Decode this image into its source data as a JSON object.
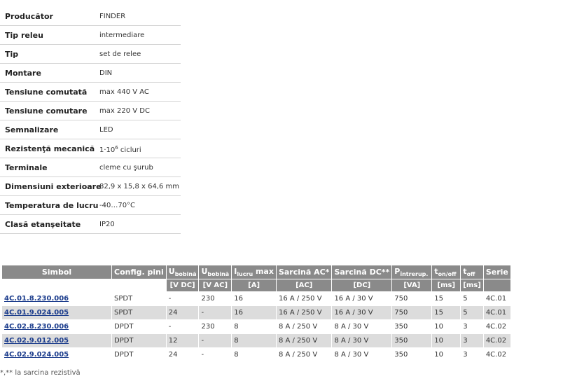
{
  "specs": [
    {
      "label": "Producător",
      "value": "FINDER"
    },
    {
      "label": "Tip releu",
      "value": "intermediare"
    },
    {
      "label": "Tip",
      "value": "set de relee"
    },
    {
      "label": "Montare",
      "value": "DIN"
    },
    {
      "label": "Tensiune comutată",
      "value": "max 440 V AC"
    },
    {
      "label": "Tensiune comutare",
      "value": "max 220 V DC"
    },
    {
      "label": "Semnalizare",
      "value": "LED"
    },
    {
      "label": "Rezistenţă mecanică",
      "value_prefix": "1·10",
      "value_sup": "6",
      "value_suffix": " cicluri"
    },
    {
      "label": "Terminale",
      "value": "cleme cu şurub"
    },
    {
      "label": "Dimensiuni exterioare",
      "value": "82,9 x 15,8 x 64,6 mm"
    },
    {
      "label": "Temperatura de lucru",
      "value": "-40…70°C"
    },
    {
      "label": "Clasă etanşeitate",
      "value": "IP20"
    }
  ],
  "table": {
    "headers": {
      "symbol": "Simbol",
      "config": "Config. pini",
      "u_coil_dc": {
        "base": "U",
        "sub": "bobină"
      },
      "u_coil_ac": {
        "base": "U",
        "sub": "bobină"
      },
      "i_work": {
        "base": "I",
        "sub": "lucru",
        "suffix": " max"
      },
      "load_ac": "Sarcină AC*",
      "load_dc": "Sarcină DC**",
      "p_break": {
        "base": "P",
        "sub": "întrerup."
      },
      "t_onoff": {
        "base": "t",
        "sub": "on/off"
      },
      "t_off": {
        "base": "t",
        "sub": "off"
      },
      "series": "Serie"
    },
    "units": {
      "u_coil_dc": "[V DC]",
      "u_coil_ac": "[V AC]",
      "i_work": "[A]",
      "load_ac": "[AC]",
      "load_dc": "[DC]",
      "p_break": "[VA]",
      "t_onoff": "[ms]",
      "t_off": "[ms]"
    },
    "rows": [
      {
        "code": "4C.01.8.230.006",
        "config": "SPDT",
        "u_dc": "-",
        "u_ac": "230",
        "i": "16",
        "ac": "16 A / 250 V",
        "dc": "16 A / 30 V",
        "p": "750",
        "ton": "15",
        "toff": "5",
        "series": "4C.01"
      },
      {
        "code": "4C.01.9.024.005",
        "config": "SPDT",
        "u_dc": "24",
        "u_ac": "-",
        "i": "16",
        "ac": "16 A / 250 V",
        "dc": "16 A / 30 V",
        "p": "750",
        "ton": "15",
        "toff": "5",
        "series": "4C.01"
      },
      {
        "code": "4C.02.8.230.006",
        "config": "DPDT",
        "u_dc": "-",
        "u_ac": "230",
        "i": "8",
        "ac": "8 A / 250 V",
        "dc": "8 A / 30 V",
        "p": "350",
        "ton": "10",
        "toff": "3",
        "series": "4C.02"
      },
      {
        "code": "4C.02.9.012.005",
        "config": "DPDT",
        "u_dc": "12",
        "u_ac": "-",
        "i": "8",
        "ac": "8 A / 250 V",
        "dc": "8 A / 30 V",
        "p": "350",
        "ton": "10",
        "toff": "3",
        "series": "4C.02"
      },
      {
        "code": "4C.02.9.024.005",
        "config": "DPDT",
        "u_dc": "24",
        "u_ac": "-",
        "i": "8",
        "ac": "8 A / 250 V",
        "dc": "8 A / 30 V",
        "p": "350",
        "ton": "10",
        "toff": "3",
        "series": "4C.02"
      }
    ]
  },
  "footnote": "*,** la sarcina rezistivă",
  "colors": {
    "header_bg": "#8a8a8a",
    "link": "#1b3c8c",
    "row_alt": "#dcdcdc"
  }
}
